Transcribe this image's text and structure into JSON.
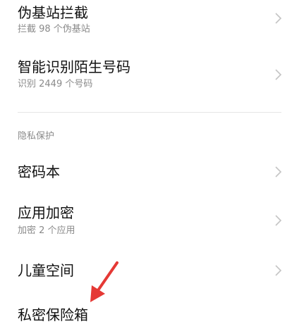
{
  "settings": {
    "items": [
      {
        "title": "伪基站拦截",
        "subtitle": "拦截 98 个伪基站"
      },
      {
        "title": "智能识别陌生号码",
        "subtitle": "识别 2449 个号码"
      }
    ],
    "privacy_section": {
      "header": "隐私保护",
      "items": [
        {
          "title": "密码本"
        },
        {
          "title": "应用加密",
          "subtitle": "加密 2 个应用"
        },
        {
          "title": "儿童空间"
        },
        {
          "title": "私密保险箱"
        }
      ]
    }
  },
  "icons": {
    "chevron": "chevron-right-icon",
    "annotation_arrow": "red-arrow-icon"
  },
  "colors": {
    "title": "#111111",
    "subtitle": "#8a8a8a",
    "chevron": "#c4c4c4",
    "divider": "#e6e6e6",
    "annotation": "#e53935"
  }
}
